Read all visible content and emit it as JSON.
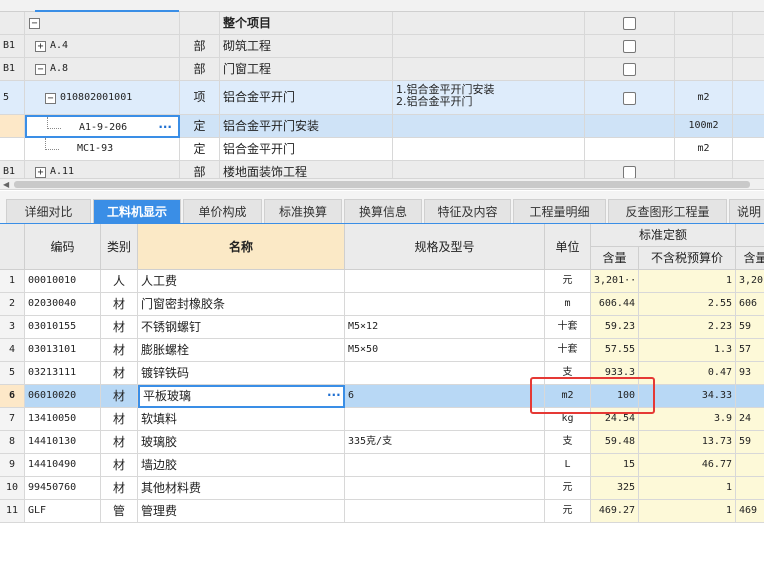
{
  "upper": {
    "rows": [
      {
        "id": "",
        "toggle": "−",
        "code": "",
        "type": "",
        "name": "整个项目",
        "feature": "",
        "unit": "",
        "kind": "root"
      },
      {
        "id": "B1",
        "toggle": "+",
        "code": "A.4",
        "type": "部",
        "name": "砌筑工程",
        "feature": "",
        "unit": "",
        "kind": "section"
      },
      {
        "id": "B1",
        "toggle": "−",
        "code": "A.8",
        "type": "部",
        "name": "门窗工程",
        "feature": "",
        "unit": "",
        "kind": "section"
      },
      {
        "id": "5",
        "toggle": "−",
        "code": "010802001001",
        "type": "项",
        "name": "铝合金平开门",
        "feature_lines": [
          "1.铝合金平开门安装",
          "2.铝合金平开门"
        ],
        "unit": "m2",
        "kind": "item"
      },
      {
        "id": "",
        "toggle": "",
        "code": "A1-9-206",
        "type": "定",
        "name": "铝合金平开门安装",
        "feature": "",
        "unit": "100m2",
        "kind": "quota-selected",
        "dots": "···"
      },
      {
        "id": "",
        "toggle": "",
        "code": "MC1-93",
        "type": "定",
        "name": "铝合金平开门",
        "feature": "",
        "unit": "m2",
        "kind": "quota"
      },
      {
        "id": "B1",
        "toggle": "+",
        "code": "A.11",
        "type": "部",
        "name": "楼地面装饰工程",
        "feature": "",
        "unit": "",
        "kind": "section"
      }
    ]
  },
  "scroll": {
    "left_arrow": "◀"
  },
  "tabs": [
    "详细对比",
    "工料机显示",
    "单价构成",
    "标准换算",
    "换算信息",
    "特征及内容",
    "工程量明细",
    "反查图形工程量",
    "说明"
  ],
  "active_tab": 1,
  "lower": {
    "headers": {
      "code": "编码",
      "cat": "类别",
      "name": "名称",
      "spec": "规格及型号",
      "unit": "单位",
      "std_group": "标准定额",
      "qty": "含量",
      "price": "不含税预算价",
      "qty2": "含量"
    },
    "rows": [
      {
        "no": "1",
        "code": "00010010",
        "cat": "人",
        "name": "人工费",
        "spec": "",
        "unit": "元",
        "qty": "3,201···",
        "price": "1",
        "qty2": "3,20"
      },
      {
        "no": "2",
        "code": "02030040",
        "cat": "材",
        "name": "门窗密封橡胶条",
        "spec": "",
        "unit": "m",
        "qty": "606.44",
        "price": "2.55",
        "qty2": "606"
      },
      {
        "no": "3",
        "code": "03010155",
        "cat": "材",
        "name": "不锈钢螺钉",
        "spec": "M5×12",
        "unit": "十套",
        "qty": "59.23",
        "price": "2.23",
        "qty2": "59"
      },
      {
        "no": "4",
        "code": "03013101",
        "cat": "材",
        "name": "膨胀螺栓",
        "spec": "M5×50",
        "unit": "十套",
        "qty": "57.55",
        "price": "1.3",
        "qty2": "57"
      },
      {
        "no": "5",
        "code": "03213111",
        "cat": "材",
        "name": "镀锌铁码",
        "spec": "",
        "unit": "支",
        "qty": "933.3",
        "price": "0.47",
        "qty2": "93"
      },
      {
        "no": "6",
        "code": "06010020",
        "cat": "材",
        "name": "平板玻璃",
        "spec": "6",
        "unit": "m2",
        "qty": "100",
        "price": "34.33",
        "qty2": "",
        "dots": "···"
      },
      {
        "no": "7",
        "code": "13410050",
        "cat": "材",
        "name": "软填料",
        "spec": "",
        "unit": "kg",
        "qty": "24.54",
        "price": "3.9",
        "qty2": "24"
      },
      {
        "no": "8",
        "code": "14410130",
        "cat": "材",
        "name": "玻璃胶",
        "spec": "335克/支",
        "unit": "支",
        "qty": "59.48",
        "price": "13.73",
        "qty2": "59"
      },
      {
        "no": "9",
        "code": "14410490",
        "cat": "材",
        "name": "墙边胶",
        "spec": "",
        "unit": "L",
        "qty": "15",
        "price": "46.77",
        "qty2": ""
      },
      {
        "no": "10",
        "code": "99450760",
        "cat": "材",
        "name": "其他材料费",
        "spec": "",
        "unit": "元",
        "qty": "325",
        "price": "1",
        "qty2": ""
      },
      {
        "no": "11",
        "code": "GLF",
        "cat": "管",
        "name": "管理费",
        "spec": "",
        "unit": "元",
        "qty": "469.27",
        "price": "1",
        "qty2": "469"
      }
    ],
    "selected_row": 5
  },
  "colors": {
    "accent": "#3a8ee6",
    "selected_row": "#b8d8f5",
    "std_col_bg": "#fdf9d8",
    "highlight_box": "#e53935",
    "header_bg": "#ebebeb"
  }
}
